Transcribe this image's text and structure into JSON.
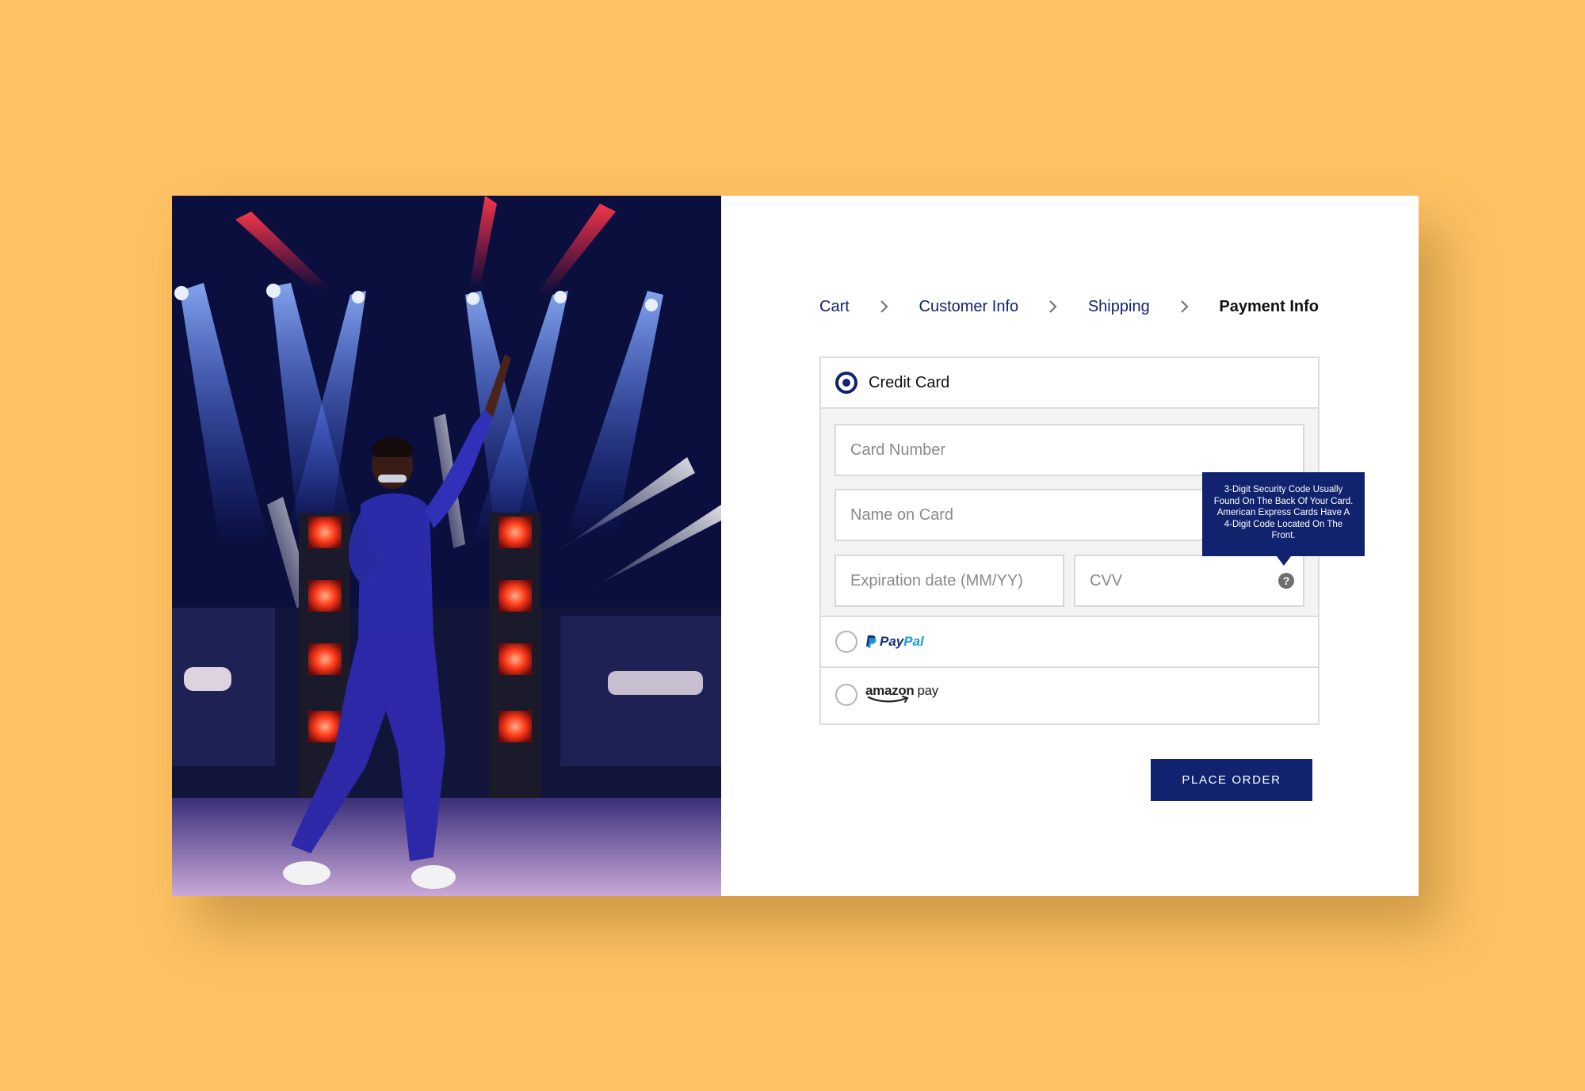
{
  "breadcrumb": {
    "cart": "Cart",
    "customer_info": "Customer Info",
    "shipping": "Shipping",
    "payment_info": "Payment Info"
  },
  "payment": {
    "credit_card_label": "Credit Card",
    "card_number_placeholder": "Card Number",
    "name_on_card_placeholder": "Name on Card",
    "expiration_placeholder": "Expiration date (MM/YY)",
    "cvv_placeholder": "CVV",
    "cvv_help_glyph": "?",
    "cvv_tooltip": "3-Digit Security Code Usually Found On The Back Of Your Card. American Express Cards Have A 4-Digit Code Located On The Front.",
    "paypal_pay": "Pay",
    "paypal_pal": "Pal",
    "amazon_brand": "amazon",
    "amazon_pay": "pay",
    "selected_method": "credit_card"
  },
  "actions": {
    "place_order": "PLACE ORDER"
  },
  "colors": {
    "background": "#FEC263",
    "accent": "#11236E",
    "paypal_dark": "#12307c",
    "paypal_light": "#179bd7"
  },
  "icons": {
    "breadcrumb_separator": "chevron-right-icon",
    "cvv_help": "question-circle-icon"
  }
}
